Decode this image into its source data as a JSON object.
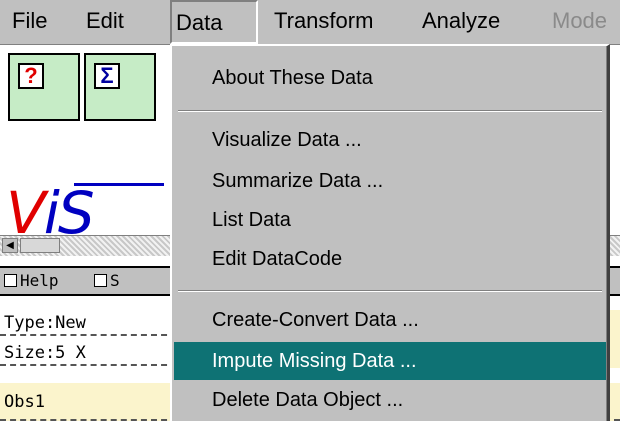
{
  "menubar": {
    "items": [
      {
        "label": "File"
      },
      {
        "label": "Edit"
      },
      {
        "label": "Data"
      },
      {
        "label": "Transform"
      },
      {
        "label": "Analyze"
      },
      {
        "label": "Mode"
      }
    ]
  },
  "toolbar": {
    "buttons": [
      {
        "icon": "question-mark-icon",
        "glyph": "?"
      },
      {
        "icon": "sigma-icon",
        "glyph": "Σ"
      }
    ]
  },
  "logo": {
    "text_v": "V",
    "text_i": "i",
    "text_s": "S"
  },
  "status_row": {
    "help_label": "Help",
    "second_label": "S"
  },
  "info_rows": [
    {
      "text": "Type:New"
    },
    {
      "text": "Size:5 X"
    },
    {
      "text": "Obs1"
    }
  ],
  "data_menu": {
    "items": [
      {
        "label": "About These Data",
        "selected": false
      },
      {
        "label": "Visualize Data ...",
        "selected": false
      },
      {
        "label": "Summarize Data ...",
        "selected": false
      },
      {
        "label": "List Data",
        "selected": false
      },
      {
        "label": "Edit DataCode",
        "selected": false
      },
      {
        "label": "Create-Convert Data ...",
        "selected": false
      },
      {
        "label": "Impute Missing Data ...",
        "selected": true
      },
      {
        "label": "Delete Data Object ...",
        "selected": false
      }
    ]
  },
  "colors": {
    "menu_bg": "#c0c0c0",
    "selection": "#0e7274",
    "button_bg": "#c6ecc6",
    "logo_red": "#e00000",
    "logo_blue": "#0000c0"
  }
}
